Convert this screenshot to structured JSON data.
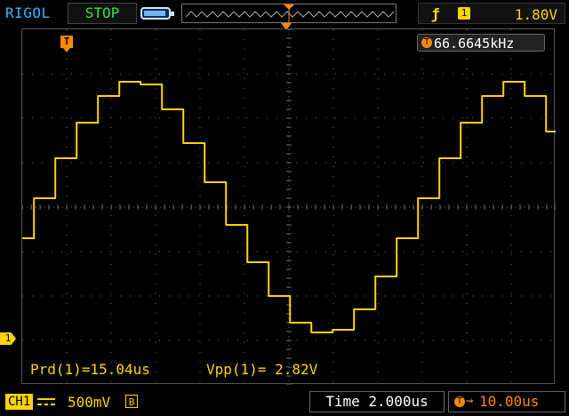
{
  "header": {
    "brand": "RIGOL",
    "run_state": "STOP",
    "trigger": {
      "edge_icon": "rising-edge-icon",
      "source_badge": "1",
      "level": "1.80V"
    }
  },
  "screen": {
    "trigger_marker_label": "T",
    "frequency_readout": "66.6645kHz",
    "frequency_icon_label": "T",
    "ch1_ground_marker": "1",
    "measurements": [
      {
        "label": "Prd(1)",
        "value": "15.04us",
        "text": "Prd(1)=15.04us"
      },
      {
        "label": "Vpp(1)",
        "value": "2.82V",
        "text": "Vpp(1)= 2.82V"
      }
    ]
  },
  "footer": {
    "channel_label": "CH1",
    "coupling_icon": "dc-coupling-icon",
    "volts_per_div": "500mV",
    "bandwidth_badge": "B",
    "timebase": "Time 2.000us",
    "trigger_offset_badge": "T",
    "trigger_offset": "10.00us"
  },
  "colors": {
    "ch1": "#ffd400",
    "brand": "#39b7ff",
    "run_state": "#34e334",
    "trigger": "#ff8a00",
    "grid": "#6a6a6a"
  },
  "chart_data": {
    "type": "line",
    "title": "",
    "xlabel": "",
    "ylabel": "",
    "x_unit": "us",
    "y_unit": "V",
    "xlim": [
      0,
      24
    ],
    "ylim": [
      -2.0,
      2.0
    ],
    "grid": true,
    "series": [
      {
        "name": "",
        "x": [
          0.0,
          0.96,
          1.92,
          2.88,
          3.84,
          4.8,
          5.76,
          6.72,
          7.68,
          8.64,
          9.6,
          10.56,
          11.52,
          12.48,
          13.44,
          14.4,
          15.36,
          16.32,
          17.28,
          18.24,
          19.2,
          20.16,
          21.12,
          22.08,
          23.04,
          24.0
        ],
        "y": [
          -0.35,
          0.1,
          0.55,
          0.95,
          1.25,
          1.41,
          1.38,
          1.1,
          0.72,
          0.28,
          -0.2,
          -0.62,
          -1.0,
          -1.3,
          -1.41,
          -1.38,
          -1.15,
          -0.78,
          -0.35,
          0.1,
          0.55,
          0.95,
          1.25,
          1.41,
          1.25,
          0.85
        ]
      }
    ]
  }
}
